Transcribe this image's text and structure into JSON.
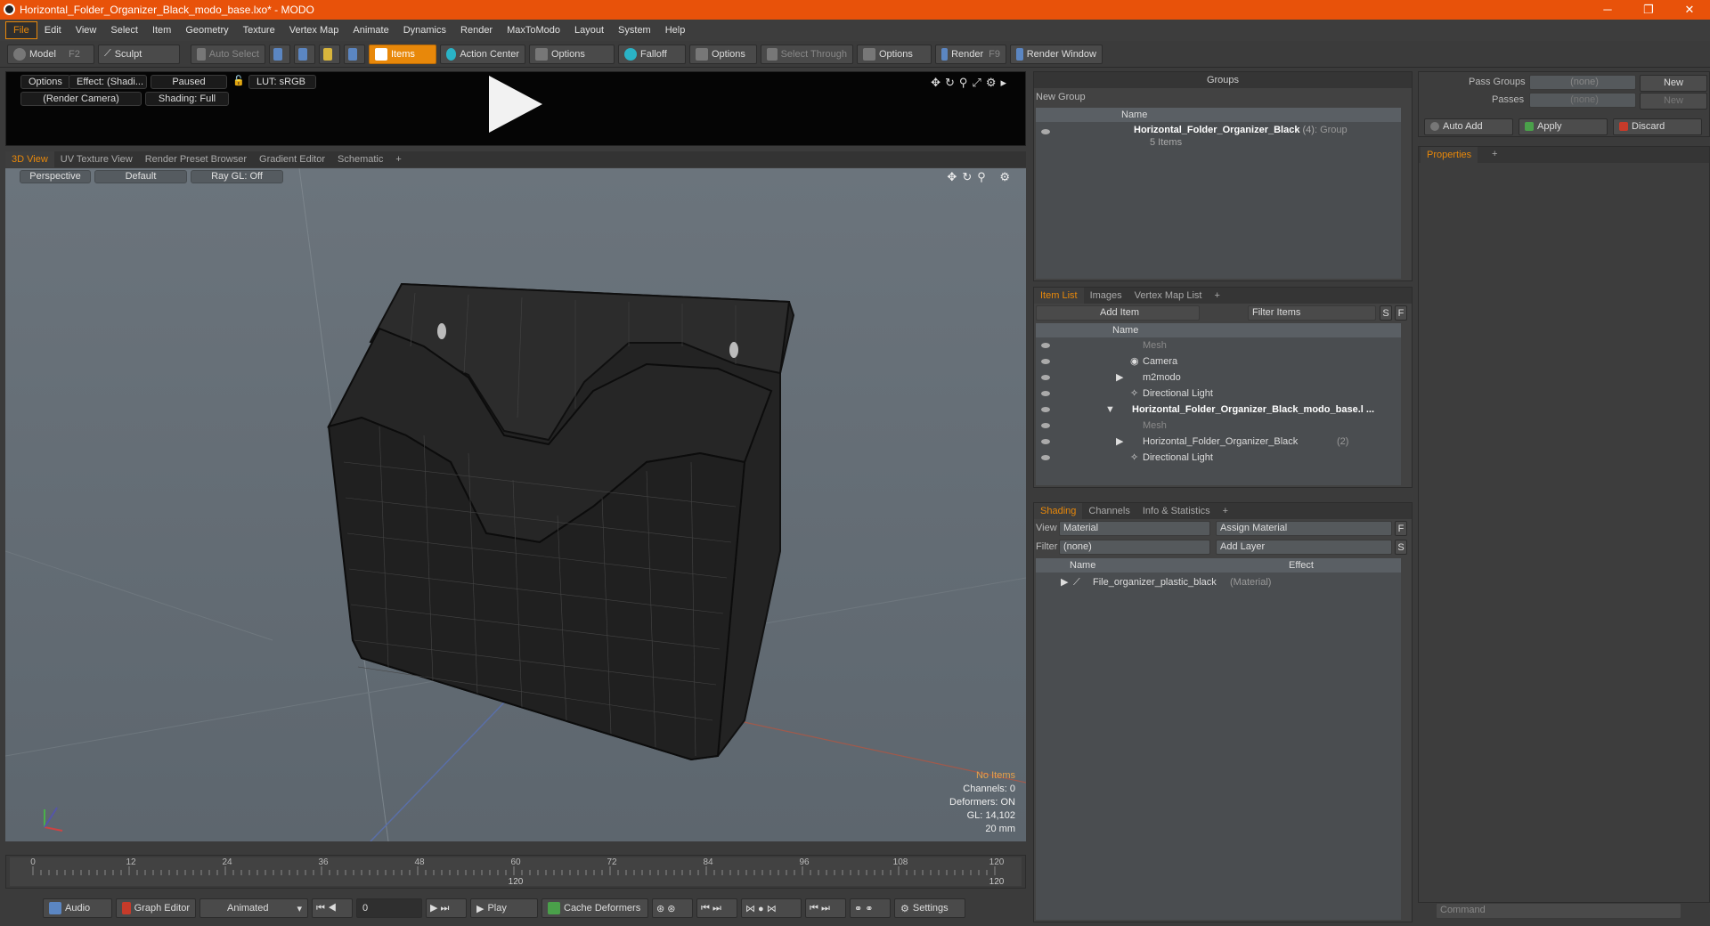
{
  "window": {
    "title": "Horizontal_Folder_Organizer_Black_modo_base.lxo* - MODO",
    "buttons": [
      "─",
      "❐",
      "✕"
    ]
  },
  "menu": [
    "File",
    "Edit",
    "View",
    "Select",
    "Item",
    "Geometry",
    "Texture",
    "Vertex Map",
    "Animate",
    "Dynamics",
    "Render",
    "MaxToModo",
    "Layout",
    "System",
    "Help"
  ],
  "toolbar": {
    "model": "Model",
    "model_key": "F2",
    "sculpt": "Sculpt",
    "auto_select": "Auto Select",
    "items": "Items",
    "action_center": "Action Center",
    "options1": "Options",
    "falloff": "Falloff",
    "options2": "Options",
    "select_through": "Select Through",
    "options3": "Options",
    "render": "Render",
    "render_key": "F9",
    "render_window": "Render Window"
  },
  "preview": {
    "options": "Options",
    "effect": "Effect: (Shadi...",
    "paused": "Paused",
    "lut": "LUT: sRGB",
    "camera": "(Render Camera)",
    "shading": "Shading: Full"
  },
  "view_tabs": [
    "3D View",
    "UV Texture View",
    "Render Preset Browser",
    "Gradient Editor",
    "Schematic",
    "+"
  ],
  "viewport": {
    "perspective": "Perspective",
    "default": "Default",
    "raygl": "Ray GL: Off",
    "info": {
      "items": "No Items",
      "channels": "Channels: 0",
      "deformers": "Deformers: ON",
      "gl": "GL: 14,102",
      "scale": "20 mm"
    }
  },
  "timeline": {
    "ticks": [
      "0",
      "12",
      "24",
      "36",
      "48",
      "60",
      "72",
      "84",
      "96",
      "108",
      "120"
    ],
    "sub": [
      "120",
      "120"
    ]
  },
  "bottom": {
    "audio": "Audio",
    "graph": "Graph Editor",
    "animated": "Animated",
    "frame": "0",
    "play": "Play",
    "cache": "Cache Deformers",
    "settings": "Settings"
  },
  "groups": {
    "title": "Groups",
    "new_group": "New Group",
    "col_name": "Name",
    "item_name": "Horizontal_Folder_Organizer_Black",
    "item_count": "(4)",
    "item_type": ": Group",
    "item_sub": "5 Items"
  },
  "pass": {
    "pass_groups": "Pass Groups",
    "passes": "Passes",
    "none": "(none)",
    "new": "New",
    "auto_add": "Auto Add",
    "apply": "Apply",
    "discard": "Discard"
  },
  "properties": {
    "tab": "Properties",
    "plus": "+"
  },
  "itemlist": {
    "tabs": [
      "Item List",
      "Images",
      "Vertex Map List",
      "+"
    ],
    "add_item": "Add Item",
    "filter": "Filter Items",
    "s": "S",
    "f": "F",
    "col_name": "Name",
    "rows": [
      {
        "label": "Mesh",
        "dim": true,
        "indent": 1
      },
      {
        "label": "Camera",
        "dim": false,
        "indent": 1
      },
      {
        "label": "m2modo",
        "dim": false,
        "indent": 1
      },
      {
        "label": "Directional Light",
        "dim": false,
        "indent": 1
      },
      {
        "label": "Horizontal_Folder_Organizer_Black_modo_base.l ...",
        "dim": false,
        "indent": 0,
        "bold": true
      },
      {
        "label": "Mesh",
        "dim": true,
        "indent": 1
      },
      {
        "label": "Horizontal_Folder_Organizer_Black",
        "count": "(2)",
        "dim": false,
        "indent": 1
      },
      {
        "label": "Directional Light",
        "dim": false,
        "indent": 1
      }
    ]
  },
  "shading": {
    "tabs": [
      "Shading",
      "Channels",
      "Info & Statistics",
      "+"
    ],
    "view_lbl": "View",
    "view_val": "Material",
    "assign": "Assign Material",
    "filter_lbl": "Filter",
    "filter_val": "(none)",
    "add_layer": "Add Layer",
    "f": "F",
    "s": "S",
    "col_name": "Name",
    "col_effect": "Effect",
    "row": "File_organizer_plastic_black",
    "row_type": "(Material)"
  },
  "command": {
    "placeholder": "Command"
  }
}
